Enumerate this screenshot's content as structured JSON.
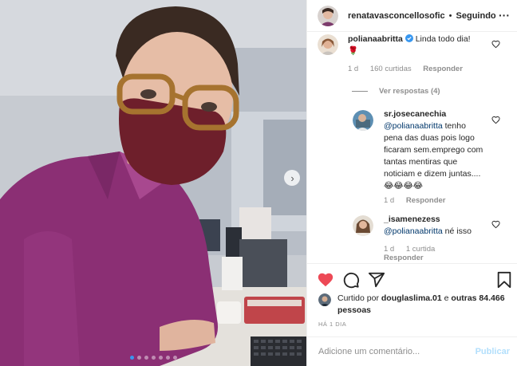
{
  "post": {
    "author": "renatavasconcellosofic",
    "separator": "•",
    "follow_label": "Seguindo",
    "more_icon": "more-icon",
    "photo_dots": 7,
    "photo_active_dot": 0
  },
  "comments": [
    {
      "username": "polianaabritta",
      "verified": true,
      "text": "Linda todo dia!",
      "emoji": "🌹",
      "time": "1 d",
      "likes": "160 curtidas",
      "reply_label": "Responder"
    },
    {
      "view_replies": "Ver respostas (4)"
    },
    {
      "username": "sr.josecanechia",
      "mention": "@polianaabritta",
      "text": "tenho pena das duas pois logo ficaram sem.emprego com tantas mentiras que noticiam e dizem juntas....😂😂😂😂",
      "time": "1 d",
      "reply_label": "Responder"
    },
    {
      "username": "_isamenezess",
      "mention": "@polianaabritta",
      "text": "né isso",
      "time": "1 d",
      "likes": "1 curtida",
      "reply_label": "Responder"
    }
  ],
  "likes": {
    "prefix": "Curtido por",
    "user": "douglaslima.01",
    "middle": "e",
    "others": "outras 84.466 pessoas"
  },
  "time_ago": "HÁ 1 DIA",
  "comment_box": {
    "placeholder": "Adicione um comentário...",
    "post_label": "Publicar"
  },
  "colors": {
    "liked_heart": "#ed4956",
    "verified": "#3897f0",
    "mention": "#00376b",
    "muted": "#8e8e8e",
    "publish_disabled": "#b2dffc"
  }
}
